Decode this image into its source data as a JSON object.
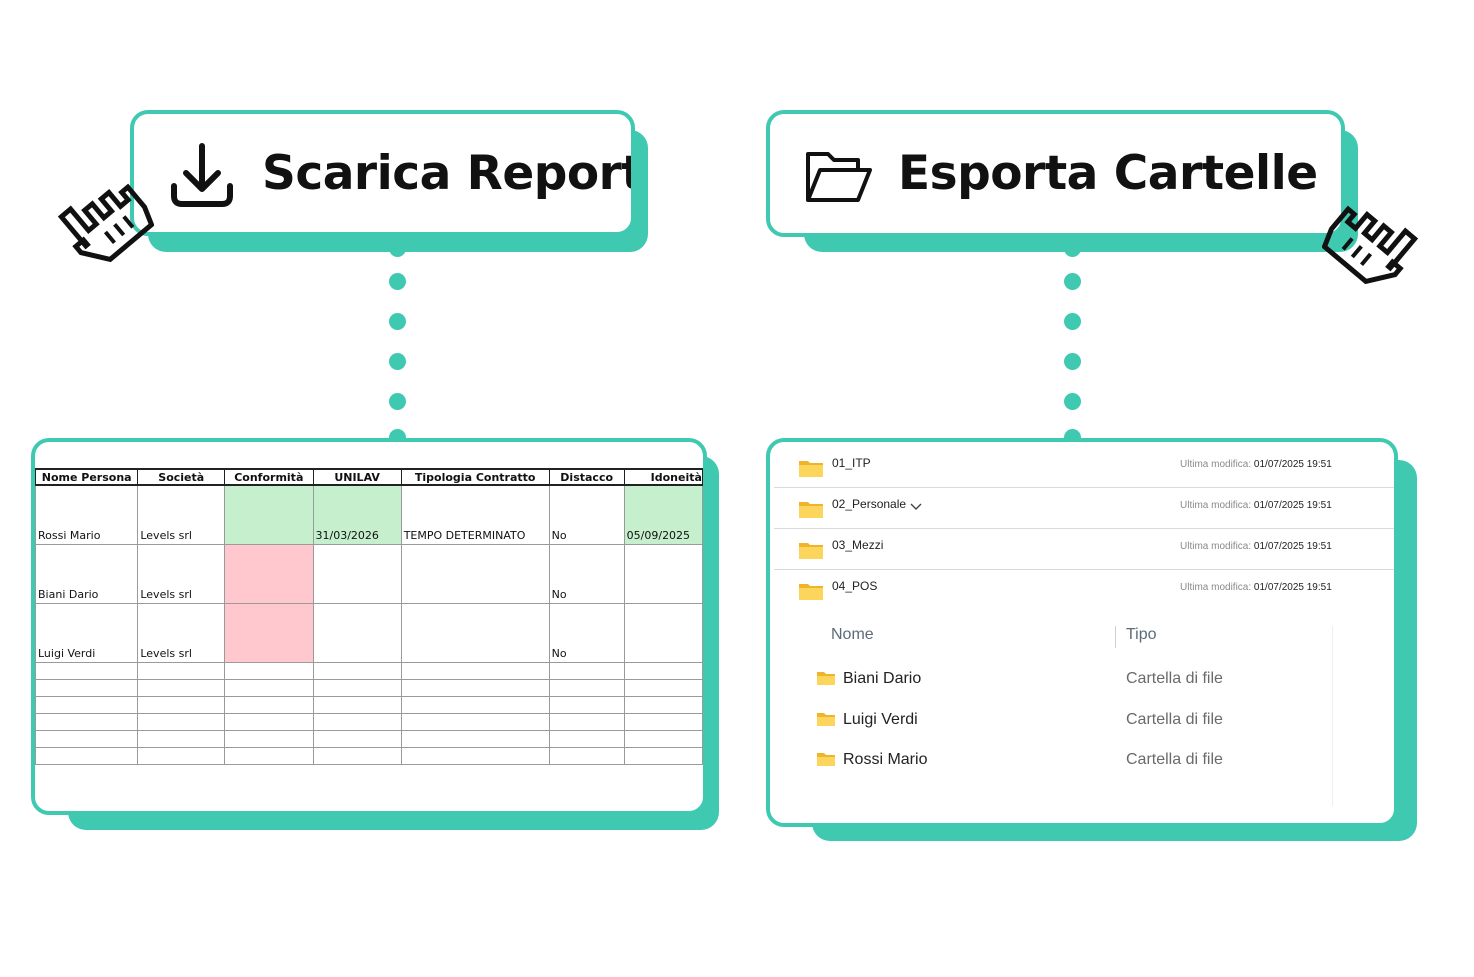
{
  "colors": {
    "accent": "#40c9b1",
    "green_cell": "#c6efce",
    "red_cell": "#ffc7ce",
    "folder": "#f5c542"
  },
  "download_button": {
    "label": "Scarica Report",
    "icon": "download-icon"
  },
  "export_button": {
    "label": "Esporta Cartelle",
    "icon": "folder-open-icon"
  },
  "cursor_icon": "pointer-hand-icon",
  "report": {
    "headers": [
      "Nome Persona",
      "Società",
      "Conformità",
      "UNILAV",
      "Tipologia Contratto",
      "Distacco",
      "Idoneità"
    ],
    "rows": [
      [
        "Rossi Mario",
        "Levels srl",
        "",
        "31/03/2026",
        "TEMPO DETERMINATO",
        "No",
        "05/09/2025"
      ],
      [
        "Biani Dario",
        "Levels srl",
        "",
        "",
        "",
        "No",
        ""
      ],
      [
        "Luigi Verdi",
        "Levels srl",
        "",
        "",
        "",
        "No",
        ""
      ]
    ]
  },
  "folders": {
    "modified_label": "Ultima modifica:",
    "items": [
      {
        "name": "01_ITP",
        "modified": "01/07/2025 19:51"
      },
      {
        "name": "02_Personale",
        "modified": "01/07/2025 19:51"
      },
      {
        "name": "03_Mezzi",
        "modified": "01/07/2025 19:51"
      },
      {
        "name": "04_POS",
        "modified": "01/07/2025 19:51"
      }
    ]
  },
  "subfolder_list": {
    "col_name": "Nome",
    "col_type": "Tipo",
    "rows": [
      {
        "name": "Biani Dario",
        "type": "Cartella di file"
      },
      {
        "name": "Luigi Verdi",
        "type": "Cartella di file"
      },
      {
        "name": "Rossi Mario",
        "type": "Cartella di file"
      }
    ]
  }
}
